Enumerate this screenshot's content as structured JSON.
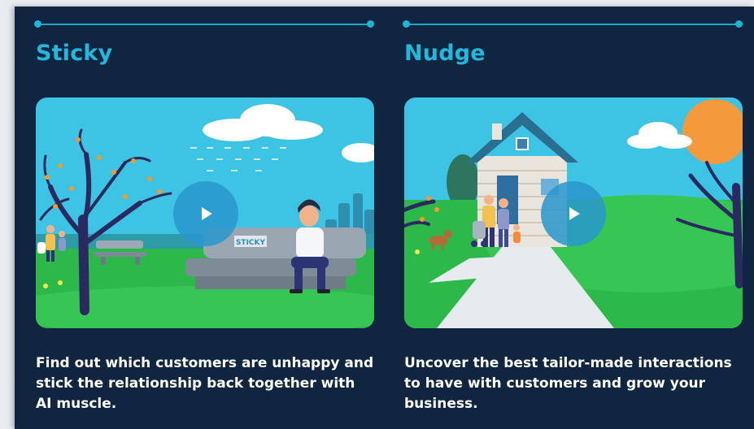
{
  "cards": [
    {
      "title": "Sticky",
      "description": "Find out which customers are unhappy and stick the relationship back together with AI muscle.",
      "sign_text": "STICKY",
      "play_icon": "play-icon"
    },
    {
      "title": "Nudge",
      "description": "Uncover the best tailor-made interactions to have with customers and grow your business.",
      "play_icon": "play-icon"
    }
  ],
  "colors": {
    "panel_bg": "#0f2540",
    "accent": "#22b8dc",
    "text": "#ffffff"
  }
}
